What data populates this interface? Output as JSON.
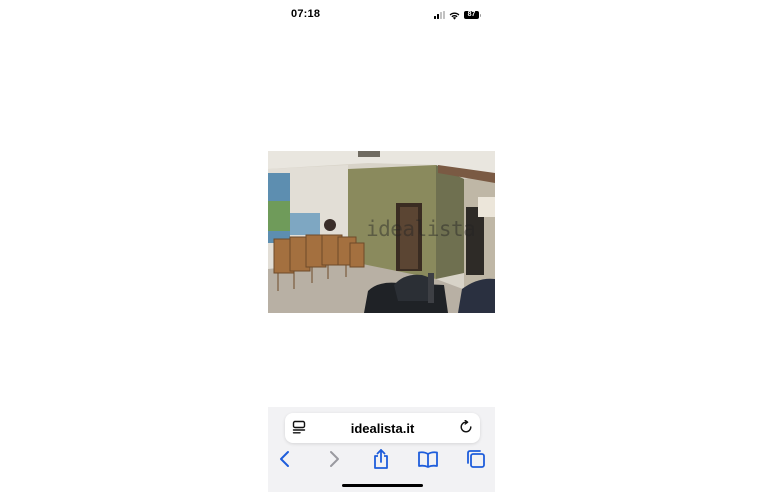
{
  "status_bar": {
    "time": "07:18",
    "battery": "87",
    "icons": [
      "cellular-signal-icon",
      "wifi-icon",
      "battery-icon"
    ]
  },
  "listing_photo": {
    "watermark": "idealista"
  },
  "browser": {
    "url": "idealista.it",
    "accent_color": "#1e5ddb",
    "disabled_color": "#9a9aa0",
    "toolbar_icons": [
      "back-icon",
      "forward-icon",
      "share-icon",
      "bookmarks-icon",
      "tabs-icon"
    ],
    "address_icons": [
      "page-menu-icon",
      "reload-icon"
    ]
  }
}
